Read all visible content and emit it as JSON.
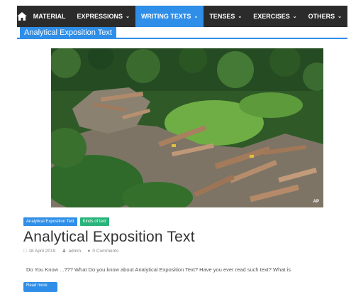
{
  "nav": {
    "items": [
      {
        "label": "MATERIAL",
        "dropdown": false,
        "active": false
      },
      {
        "label": "EXPRESSIONS",
        "dropdown": true,
        "active": false
      },
      {
        "label": "WRITING TEXTS",
        "dropdown": true,
        "active": true
      },
      {
        "label": "TENSES",
        "dropdown": true,
        "active": false
      },
      {
        "label": "EXERCISES",
        "dropdown": true,
        "active": false
      },
      {
        "label": "OTHERS",
        "dropdown": true,
        "active": false
      }
    ],
    "caret": "⌄",
    "home_icon": "home-icon"
  },
  "page": {
    "category_title": "Analytical Exposition Text"
  },
  "post": {
    "image_credit": "AP",
    "tags": [
      "Analytical Exposition Text",
      "Kinds of text"
    ],
    "title": "Analytical Exposition Text",
    "date": "18 April 2019",
    "author": "admin",
    "comments": "0 Comments",
    "excerpt": "Do You Know ...??? What Do you know about  Analytical Exposition Text? Have you ever read such text? What is",
    "read_more": "Read more"
  },
  "colors": {
    "nav_bg": "#2b2b2b",
    "accent": "#2e8ee8",
    "tag_green": "#28b47a"
  }
}
